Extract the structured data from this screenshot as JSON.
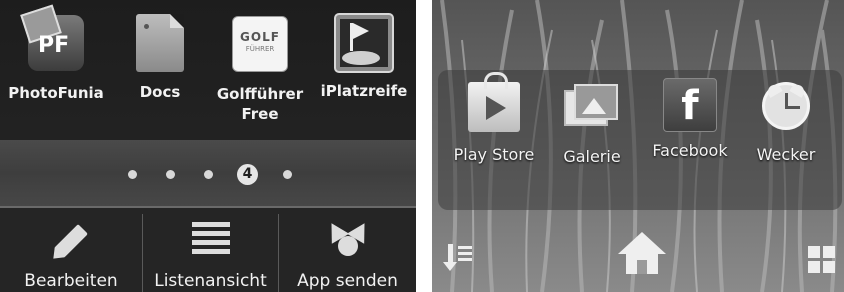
{
  "left_screen": {
    "apps": [
      {
        "name": "PhotoFunia",
        "icon": "photofunia-icon",
        "icon_text": "PF"
      },
      {
        "name": "Docs",
        "icon": "docs-icon"
      },
      {
        "name": "Golfführer Free",
        "icon": "golffuehrer-icon",
        "icon_text": "GOLF",
        "icon_subtext": "FÜHRER"
      },
      {
        "name": "iPlatzreife",
        "icon": "golf-flag-icon"
      }
    ],
    "pager": {
      "current_page": "4"
    },
    "bottom_bar": [
      {
        "label": "Bearbeiten",
        "icon": "pencil-icon"
      },
      {
        "label": "Listenansicht",
        "icon": "list-view-icon"
      },
      {
        "label": "App senden",
        "icon": "share-app-icon"
      }
    ]
  },
  "right_screen": {
    "apps": [
      {
        "name": "Play Store",
        "icon": "play-store-icon"
      },
      {
        "name": "Galerie",
        "icon": "gallery-icon"
      },
      {
        "name": "Facebook",
        "icon": "facebook-icon",
        "icon_text": "f"
      },
      {
        "name": "Wecker",
        "icon": "alarm-clock-icon"
      }
    ],
    "nav": {
      "left": "sort-icon",
      "center": "home-icon",
      "right": "app-grid-icon"
    }
  }
}
